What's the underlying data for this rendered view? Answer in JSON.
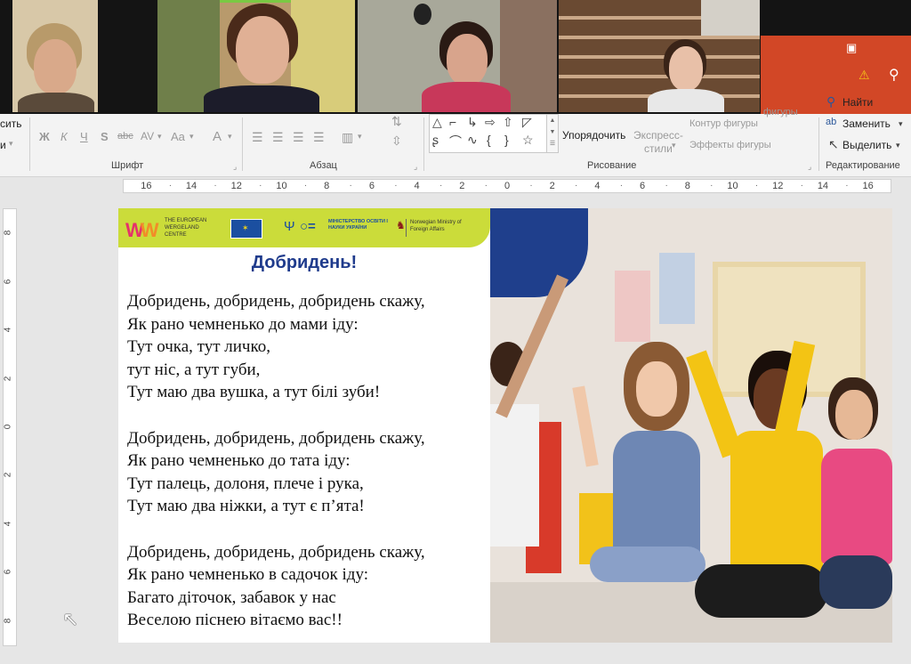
{
  "video_tiles": [
    {
      "name": "participant-1"
    },
    {
      "name": "participant-2",
      "active_speaker": true
    },
    {
      "name": "participant-3"
    },
    {
      "name": "participant-4"
    }
  ],
  "ribbon": {
    "partial_labels": {
      "left_top": "сить",
      "left_mid": "и"
    },
    "font_group": {
      "label": "Шрифт",
      "buttons": [
        "Ж",
        "К",
        "Ч",
        "S",
        "abc",
        "AV",
        "Aa",
        "A"
      ]
    },
    "paragraph_group": {
      "label": "Абзац"
    },
    "drawing_group": {
      "label": "Рисование",
      "arrange": "Упорядочить",
      "express_styles": "Экспресс-\nстили",
      "shape_fill": "фигуры",
      "shape_outline": "Контур фигуры",
      "shape_effects": "Эффекты фигуры"
    },
    "editing_group": {
      "label": "Редактирование",
      "find": "Найти",
      "replace": "Заменить",
      "select": "Выделить"
    }
  },
  "ruler": {
    "h_labels": [
      "16",
      "14",
      "12",
      "10",
      "8",
      "6",
      "4",
      "2",
      "0",
      "2",
      "4",
      "6",
      "8",
      "10",
      "12",
      "14",
      "16"
    ],
    "v_labels": [
      "8",
      "6",
      "4",
      "2",
      "0",
      "2",
      "4",
      "6",
      "8"
    ]
  },
  "slide": {
    "logos": {
      "wergeland": "THE EUROPEAN WERGELAND CENTRE",
      "ministry": "МІНІСТЕРСТВО ОСВІТИ І НАУКИ УКРАЇНИ",
      "norway": "Norwegian Ministry of Foreign Affairs"
    },
    "title": "Добридень!",
    "stanzas": [
      [
        "Добридень, добридень, добридень скажу,",
        "Як рано чемненько до мами іду:",
        "Тут очка, тут личко,",
        "тут ніс, а тут губи,",
        "Тут маю два вушка, а тут білі зуби!"
      ],
      [
        "Добридень, добридень, добридень скажу,",
        "Як рано чемненько до тата іду:",
        "Тут палець, долоня, плече і рука,",
        "Тут маю два ніжки, а тут є п’ята!"
      ],
      [
        "Добридень, добридень, добридень скажу,",
        "Як рано чемненько в садочок іду:",
        "Багато діточок, забавок у нас",
        "Веселою піснею вітаємо вас!!"
      ]
    ]
  },
  "colors": {
    "ribbon_accent": "#d24726",
    "banner": "#cbdc3a",
    "title": "#1f3b8c",
    "speaker_border": "#7ac943"
  }
}
